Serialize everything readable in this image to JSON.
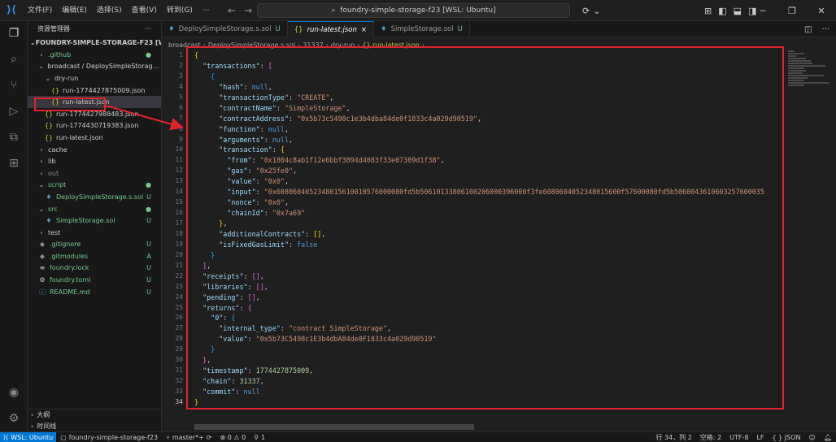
{
  "titlebar": {
    "menu": [
      "文件(F)",
      "编辑(E)",
      "选择(S)",
      "查看(V)",
      "转到(G)",
      "···"
    ],
    "search": "foundry-simple-storage-f23 [WSL: Ubuntu]"
  },
  "sidebar": {
    "title": "资源管理器",
    "more": "···",
    "folder": "FOUNDRY-SIMPLE-STORAGE-F23 [WSL: ...",
    "items": [
      {
        "label": ".github",
        "status": "●",
        "indent": 1,
        "type": "folder-closed",
        "color": "c-green"
      },
      {
        "label": "broadcast / DeploySimpleStorage.s...",
        "status": "",
        "indent": 1,
        "type": "folder-open",
        "color": ""
      },
      {
        "label": "dry-run",
        "status": "",
        "indent": 2,
        "type": "folder-open",
        "color": ""
      },
      {
        "label": "run-1774427875009.json",
        "status": "",
        "indent": 3,
        "type": "json",
        "color": ""
      },
      {
        "label": "run-latest.json",
        "status": "",
        "indent": 3,
        "type": "json",
        "color": "",
        "selected": true
      },
      {
        "label": "run-1774427988483.json",
        "status": "",
        "indent": 2,
        "type": "json",
        "color": ""
      },
      {
        "label": "run-1774430719383.json",
        "status": "",
        "indent": 2,
        "type": "json",
        "color": ""
      },
      {
        "label": "run-latest.json",
        "status": "",
        "indent": 2,
        "type": "json",
        "color": ""
      },
      {
        "label": "cache",
        "status": "",
        "indent": 1,
        "type": "folder-closed",
        "color": ""
      },
      {
        "label": "lib",
        "status": "",
        "indent": 1,
        "type": "folder-closed",
        "color": ""
      },
      {
        "label": "out",
        "status": "",
        "indent": 1,
        "type": "folder-closed",
        "color": "c-gray"
      },
      {
        "label": "script",
        "status": "●",
        "indent": 1,
        "type": "folder-open",
        "color": "c-green"
      },
      {
        "label": "DeploySimpleStorage.s.sol",
        "status": "U",
        "indent": 2,
        "type": "sol",
        "color": "c-green"
      },
      {
        "label": "src",
        "status": "●",
        "indent": 1,
        "type": "folder-open",
        "color": "c-green"
      },
      {
        "label": "SimpleStorage.sol",
        "status": "U",
        "indent": 2,
        "type": "sol",
        "color": "c-green"
      },
      {
        "label": "test",
        "status": "",
        "indent": 1,
        "type": "folder-closed",
        "color": ""
      },
      {
        "label": ".gitignore",
        "status": "U",
        "indent": 1,
        "type": "git",
        "color": "c-green"
      },
      {
        "label": ".gitmodules",
        "status": "A",
        "indent": 1,
        "type": "git",
        "color": "c-green"
      },
      {
        "label": "foundry.lock",
        "status": "U",
        "indent": 1,
        "type": "lock",
        "color": "c-green"
      },
      {
        "label": "foundry.toml",
        "status": "U",
        "indent": 1,
        "type": "gear",
        "color": "c-green"
      },
      {
        "label": "README.md",
        "status": "U",
        "indent": 1,
        "type": "info",
        "color": "c-green"
      }
    ],
    "outline": "大纲",
    "timeline": "时间线"
  },
  "tabs": [
    {
      "label": "DeploySimpleStorage.s.sol",
      "badge": "U",
      "icon": "sol",
      "active": false
    },
    {
      "label": "run-latest.json",
      "badge": "×",
      "icon": "json",
      "active": true
    },
    {
      "label": "SimpleStorage.sol",
      "badge": "U",
      "icon": "sol",
      "active": false
    }
  ],
  "breadcrumb": [
    "broadcast",
    "DeploySimpleStorage.s.sol",
    "31337",
    "dry-run",
    "{} run-latest.json",
    "..."
  ],
  "code": {
    "line_numbers": [
      "1",
      "2",
      "3",
      "4",
      "5",
      "6",
      "7",
      "8",
      "9",
      "10",
      "11",
      "12",
      "13",
      "14",
      "15",
      "16",
      "17",
      "18",
      "19",
      "20",
      "21",
      "22",
      "23",
      "24",
      "25",
      "26",
      "27",
      "28",
      "29",
      "30",
      "31",
      "32",
      "33",
      "34"
    ],
    "tx_hash_value": "null",
    "tx_type": "\"CREATE\"",
    "contract_name": "\"SimpleStorage\"",
    "contract_address": "\"0x5b73c5498c1e3b4dba84de0f1833c4a029d90519\"",
    "from": "\"0x1804c8ab1f12e6bbf3894d4083f33e07309d1f38\"",
    "gas": "\"0x25fe0\"",
    "value": "\"0x0\"",
    "input": "\"0x6080604052348015610010576000080fd5b50610133806100206000396000f3fe6080604052348015600f57600080fd5b5060043610603257600035",
    "nonce": "\"0x0\"",
    "chain_id": "\"0x7a69\"",
    "internal_type": "\"contract SimpleStorage\"",
    "returns_value": "\"0x5b73C5498c1E3b4dbA84de0F1833c4a029d90519\"",
    "timestamp": "1774427875009",
    "chain": "31337",
    "commit": "null"
  },
  "status": {
    "remote": "WSL: Ubuntu",
    "workspace": "foundry-simple-storage-f23",
    "branch": "master*+",
    "problems": "⊗ 0 ⚠ 0",
    "ports": "1",
    "position": "行 34，列 2",
    "spaces": "空格: 2",
    "encoding": "UTF-8",
    "eol": "LF",
    "language": "{ } JSON"
  }
}
